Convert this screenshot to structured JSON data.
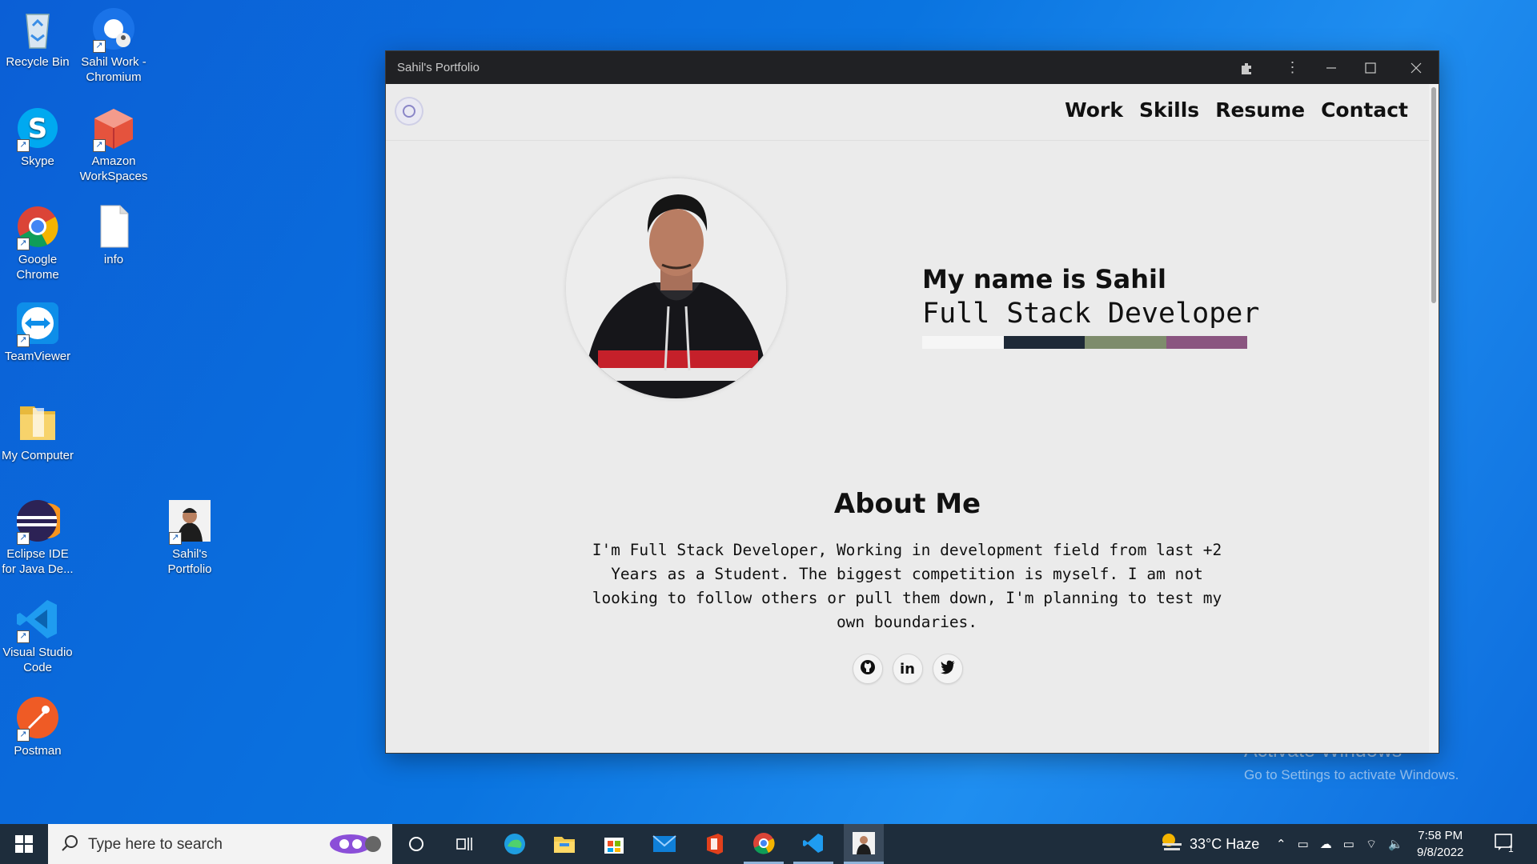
{
  "desktop": {
    "icons": [
      {
        "name": "recycle-bin",
        "label": "Recycle Bin"
      },
      {
        "name": "sahil-work-chromium",
        "label": "Sahil Work - Chromium"
      },
      {
        "name": "skype",
        "label": "Skype"
      },
      {
        "name": "amazon-workspaces",
        "label": "Amazon WorkSpaces"
      },
      {
        "name": "google-chrome",
        "label": "Google Chrome"
      },
      {
        "name": "info",
        "label": "info"
      },
      {
        "name": "teamviewer",
        "label": "TeamViewer"
      },
      {
        "name": "my-computer",
        "label": "My Computer"
      },
      {
        "name": "eclipse-ide",
        "label": "Eclipse IDE for Java De..."
      },
      {
        "name": "sahils-portfolio",
        "label": "Sahil's Portfolio"
      },
      {
        "name": "visual-studio-code",
        "label": "Visual Studio Code"
      },
      {
        "name": "postman",
        "label": "Postman"
      }
    ],
    "watermark": {
      "line1": "Activate Windows",
      "line2": "Go to Settings to activate Windows."
    }
  },
  "window": {
    "title": "Sahil's Portfolio",
    "nav": [
      "Work",
      "Skills",
      "Resume",
      "Contact"
    ],
    "hero": {
      "name": "My name is Sahil",
      "role": "Full Stack Developer",
      "palette": [
        "#f6f6f6",
        "#1e2937",
        "#7e8c6c",
        "#8a5580"
      ]
    },
    "about": {
      "title": "About Me",
      "text": "I'm Full Stack Developer, Working in development field from last +2 Years as a Student. The biggest competition is myself. I am not looking to follow others or pull them down, I'm planning to test my own boundaries."
    },
    "socials": [
      "github-icon",
      "linkedin-icon",
      "twitter-icon"
    ]
  },
  "taskbar": {
    "search_placeholder": "Type here to search",
    "weather": "33°C  Haze",
    "time": "7:58 PM",
    "date": "9/8/2022",
    "notification_count": "1"
  }
}
